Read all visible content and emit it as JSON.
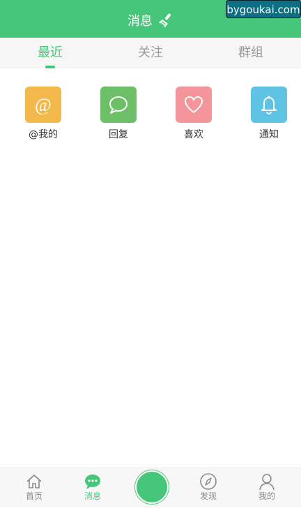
{
  "header": {
    "title": "消息",
    "clear_icon": "broom-icon"
  },
  "watermark": "bygoukai.com",
  "tabs": [
    {
      "label": "最近",
      "active": true
    },
    {
      "label": "关注",
      "active": false
    },
    {
      "label": "群组",
      "active": false
    }
  ],
  "quick": [
    {
      "label": "@我的",
      "icon": "at-icon",
      "color": "#f2b84b"
    },
    {
      "label": "回复",
      "icon": "speech-bubble-icon",
      "color": "#6dbf67"
    },
    {
      "label": "喜欢",
      "icon": "heart-icon",
      "color": "#f3959a"
    },
    {
      "label": "通知",
      "icon": "bell-icon",
      "color": "#5fc3e4"
    }
  ],
  "bottom_nav": [
    {
      "label": "首页",
      "icon": "home-icon"
    },
    {
      "label": "消息",
      "icon": "message-icon",
      "active": true
    },
    {
      "label": "发现",
      "icon": "compass-icon"
    },
    {
      "label": "我的",
      "icon": "user-icon"
    }
  ],
  "colors": {
    "accent": "#46c67a"
  }
}
